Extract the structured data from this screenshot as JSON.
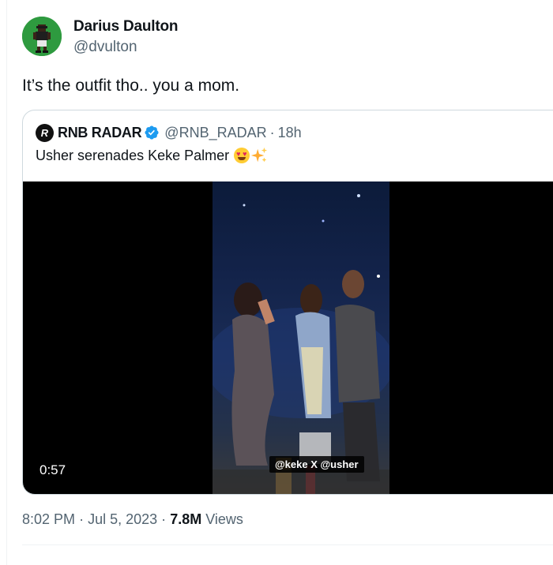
{
  "author": {
    "name": "Darius Daulton",
    "handle": "@dvulton",
    "avatar_color": "#2e9a3f"
  },
  "tweet": {
    "text": "It’s the outfit tho.. you a mom."
  },
  "quoted_tweet": {
    "avatar_letter": "R",
    "name": "RNB RADAR",
    "verified": true,
    "handle": "@RNB_RADAR",
    "separator": "·",
    "time": "18h",
    "text": "Usher serenades Keke Palmer",
    "emojis": [
      "smiling-face-with-heart-eyes-icon",
      "sparkles-icon"
    ],
    "video": {
      "duration": "0:57",
      "caption_tag": "@keke X @usher"
    }
  },
  "meta": {
    "time": "8:02 PM",
    "separator1": "·",
    "date": "Jul 5, 2023",
    "separator2": "·",
    "views_count": "7.8M",
    "views_label": "Views"
  },
  "colors": {
    "verified_blue": "#1d9bf0",
    "secondary_text": "#536471",
    "border": "#cfd9de"
  }
}
